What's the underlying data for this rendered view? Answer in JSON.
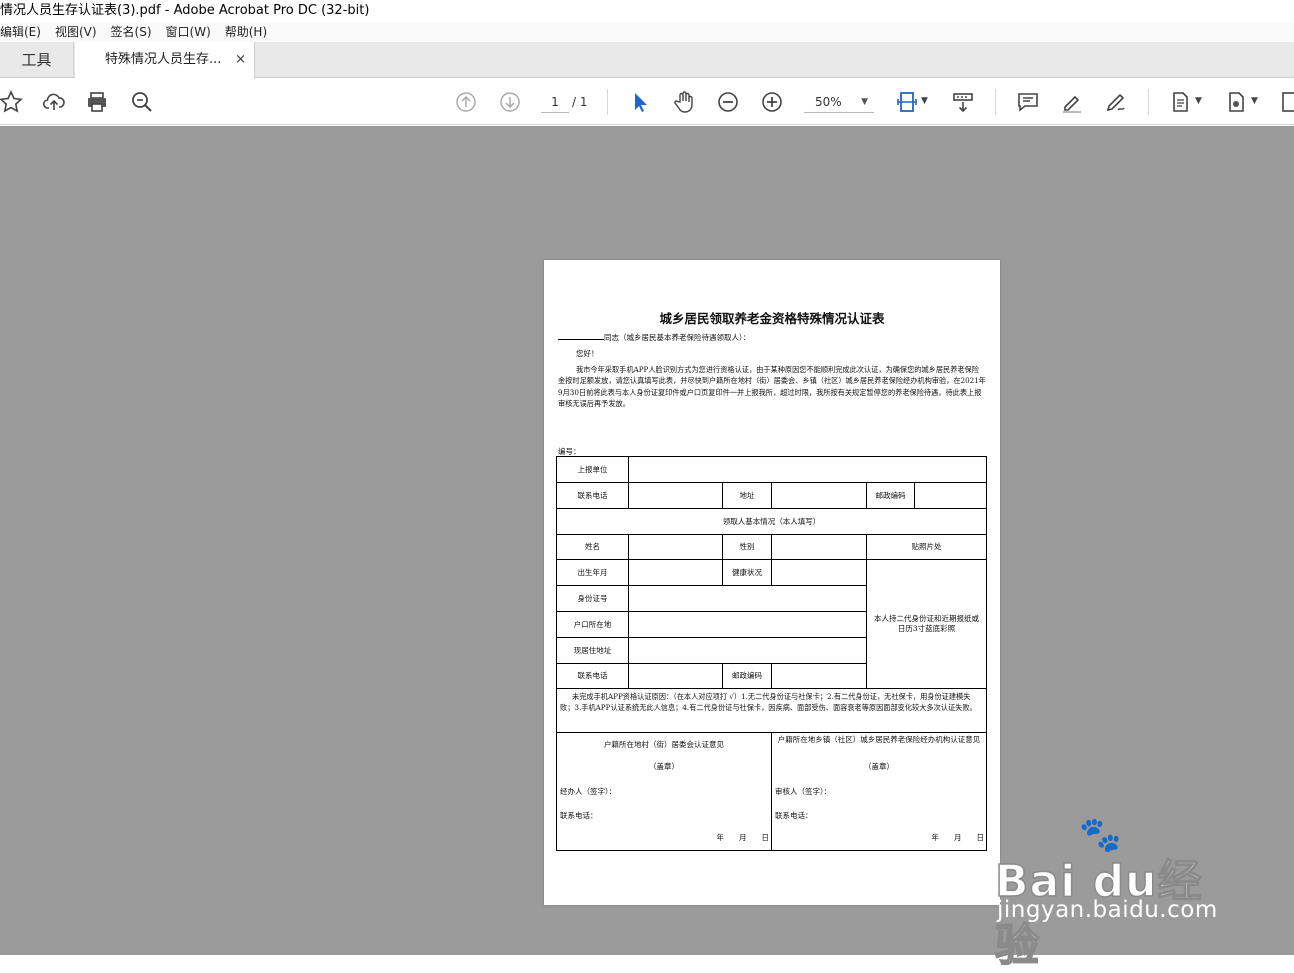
{
  "window": {
    "title": "情况人员生存认证表(3).pdf - Adobe Acrobat Pro DC (32-bit)"
  },
  "menu": [
    "编辑(E)",
    "视图(V)",
    "签名(S)",
    "窗口(W)",
    "帮助(H)"
  ],
  "tabs": {
    "tools": "工具",
    "document": "特殊情况人员生存...",
    "close": "×"
  },
  "toolbar": {
    "page_current": "1",
    "page_total": "/ 1",
    "zoom": "50%"
  },
  "document": {
    "title": "城乡居民领取养老金资格特殊情况认证表",
    "salute": "同志（城乡居民基本养老保险待遇领取人）：",
    "greeting": "您好！",
    "paragraph": "我市今年采取手机APP人脸识别方式为您进行资格认证，由于某种原因您不能顺利完成此次认证，为确保您的城乡居民养老保险金按时足额发放，请您认真填写此表，并尽快到户籍所在地村（街）居委会、乡镇（社区）城乡居民养老保险经办机构审验，在2021年9月30日前将此表与本人身份证复印件或户口页复印件一并上报我所，超过时限，我所按有关规定暂停您的养老保险待遇，待此表上报审核无误后再予发放。",
    "bianhao": "编号：",
    "form": {
      "report_unit": "上报单位",
      "phone": "联系电话",
      "address": "地址",
      "postcode": "邮政编码",
      "section": "领取人基本情况（本人填写）",
      "name": "姓名",
      "gender": "性别",
      "photo": "贴照片处",
      "birth": "出生年月",
      "health": "健康状况",
      "id_number": "身份证号",
      "hukou": "户口所在地",
      "residence": "现居住地址",
      "phone2": "联系电话",
      "postcode2": "邮政编码",
      "photo_note": "本人持二代身份证和近期报纸或日历3寸蓝底彩照",
      "reason": "未完成手机APP资格认证原因：（在本人对应项打 √）1.无二代身份证与社保卡；2.有二代身份证，无社保卡，用身份证建模失败；3.手机APP认证系统无此人信息；4.有二代身份证与社保卡，因疾病、面部受伤、面容衰老等原因面部变化较大多次认证失败。",
      "left_title": "户籍所在地村（街）居委会认证意见",
      "right_title": "户籍所在地乡镇（社区）城乡居民养老保险经办机构认证意见",
      "seal": "（盖章）",
      "handler": "经办人（签字）：",
      "reviewer": "审核人（签字）：",
      "contact": "联系电话：",
      "date": "年　　月　　日"
    }
  },
  "watermark": {
    "brand": "Bai  du经验",
    "url": "jingyan.baidu.com"
  }
}
